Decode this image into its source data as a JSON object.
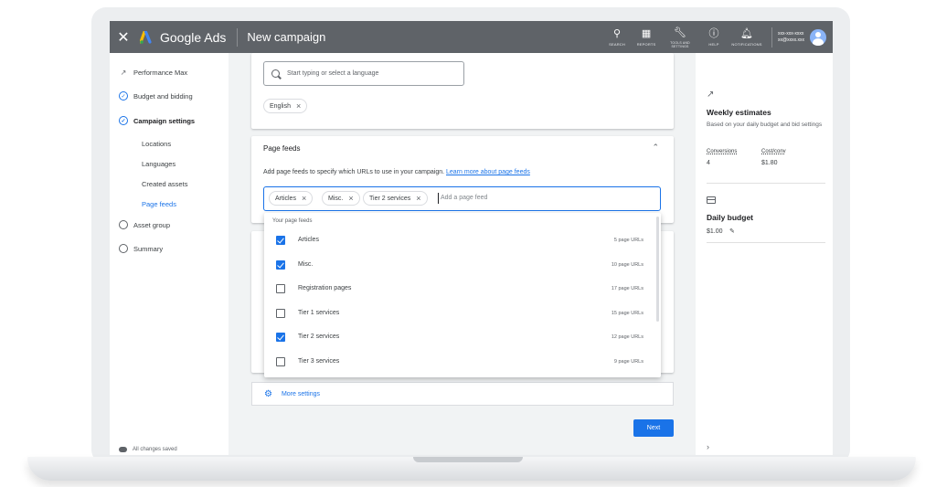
{
  "header": {
    "close_icon": "close-icon",
    "brand": "Google Ads",
    "campaign_title": "New campaign",
    "tools": [
      {
        "label": "SEARCH",
        "icon": "search-icon"
      },
      {
        "label": "REPORTS",
        "icon": "reports-icon"
      },
      {
        "label": "TOOLS AND SETTINGS",
        "icon": "wrench-icon"
      },
      {
        "label": "HELP",
        "icon": "help-icon"
      },
      {
        "label": "NOTIFICATIONS",
        "icon": "bell-icon"
      }
    ],
    "account_id": "xxx-xxx-xxxx",
    "account_email": "xx@xxxx.xxx"
  },
  "sidebar": {
    "items": [
      {
        "label": "Performance Max",
        "icon": "trend-icon"
      },
      {
        "label": "Budget and bidding",
        "icon": "check-circle-icon"
      },
      {
        "label": "Campaign settings",
        "icon": "check-circle-icon"
      }
    ],
    "subitems": [
      "Locations",
      "Languages",
      "Created assets",
      "Page feeds"
    ],
    "lower_items": [
      "Asset group",
      "Summary"
    ],
    "saved_status": "All changes saved"
  },
  "languages": {
    "placeholder": "Start typing or select a language",
    "selected_chip": "English"
  },
  "page_feeds": {
    "title": "Page feeds",
    "description": "Add page feeds to specify which URLs to use in your campaign.",
    "learn_more": "Learn more about page feeds",
    "chips": [
      "Articles",
      "Misc.",
      "Tier 2 services"
    ],
    "input_placeholder": "Add a page feed",
    "dropdown_header": "Your page feeds",
    "feeds": [
      {
        "name": "Articles",
        "count": "5 page URLs",
        "checked": true
      },
      {
        "name": "Misc.",
        "count": "10 page URLs",
        "checked": true
      },
      {
        "name": "Registration pages",
        "count": "17 page URLs",
        "checked": false
      },
      {
        "name": "Tier 1 services",
        "count": "15 page URLs",
        "checked": false
      },
      {
        "name": "Tier 2 services",
        "count": "12 page URLs",
        "checked": true
      },
      {
        "name": "Tier 3 services",
        "count": "9 page URLs",
        "checked": false
      }
    ]
  },
  "more_settings": "More settings",
  "next_button": "Next",
  "estimates": {
    "title": "Weekly estimates",
    "subtitle": "Based on your daily budget and bid settings",
    "conversions_label": "Conversions",
    "conversions_value": "4",
    "cost_label": "Cost/conv",
    "cost_value": "$1.80"
  },
  "budget": {
    "title": "Daily budget",
    "value": "$1.00"
  },
  "colors": {
    "accent": "#1a73e8",
    "topbar": "#5f6368"
  }
}
